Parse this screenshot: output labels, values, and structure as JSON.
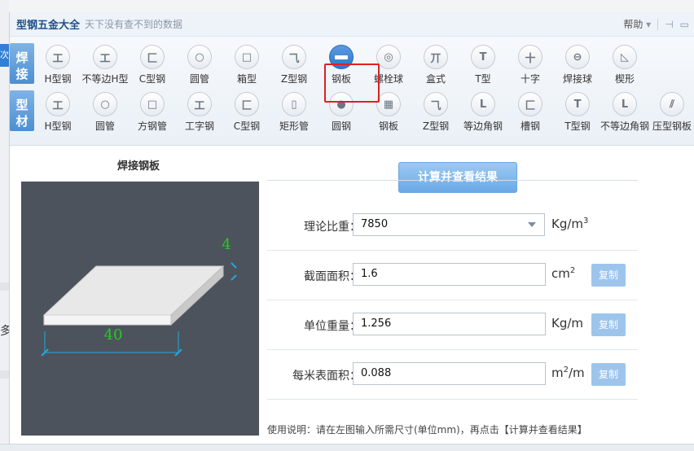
{
  "app": {
    "title": "型钢五金大全",
    "subtitle": "天下没有查不到的数据",
    "help_label": "帮助"
  },
  "background": {
    "left_tab_text": "次",
    "left_fragment": "多"
  },
  "toolbar": {
    "groups": [
      {
        "label_line1": "焊",
        "label_line2": "接",
        "items": [
          {
            "label": "H型钢",
            "icon": "h-beam-icon",
            "glyph": "工"
          },
          {
            "label": "不等边H型",
            "icon": "unequal-h-beam-icon",
            "glyph": "工"
          },
          {
            "label": "C型钢",
            "icon": "c-channel-icon",
            "glyph": "匚"
          },
          {
            "label": "圆管",
            "icon": "round-pipe-icon",
            "glyph": "○"
          },
          {
            "label": "箱型",
            "icon": "box-section-icon",
            "glyph": "□"
          },
          {
            "label": "Z型钢",
            "icon": "z-section-icon",
            "glyph": "⺄"
          },
          {
            "label": "钢板",
            "icon": "steel-plate-icon",
            "glyph": "▬",
            "active": true
          },
          {
            "label": "螺栓球",
            "icon": "bolt-ball-icon",
            "glyph": "◎"
          },
          {
            "label": "盒式",
            "icon": "box-type-icon",
            "glyph": "丌"
          },
          {
            "label": "T型",
            "icon": "t-section-icon",
            "glyph": "T"
          },
          {
            "label": "十字",
            "icon": "cross-section-icon",
            "glyph": "十"
          },
          {
            "label": "焊接球",
            "icon": "welded-ball-icon",
            "glyph": "⊖"
          },
          {
            "label": "楔形",
            "icon": "wedge-icon",
            "glyph": "◺"
          }
        ]
      },
      {
        "label_line1": "型",
        "label_line2": "材",
        "items": [
          {
            "label": "H型钢",
            "icon": "h-beam-icon",
            "glyph": "工"
          },
          {
            "label": "圆管",
            "icon": "round-pipe-icon",
            "glyph": "○"
          },
          {
            "label": "方钢管",
            "icon": "square-pipe-icon",
            "glyph": "□"
          },
          {
            "label": "工字钢",
            "icon": "i-beam-icon",
            "glyph": "工"
          },
          {
            "label": "C型钢",
            "icon": "c-channel-icon",
            "glyph": "匚"
          },
          {
            "label": "矩形管",
            "icon": "rect-pipe-icon",
            "glyph": "▯"
          },
          {
            "label": "圆钢",
            "icon": "round-bar-icon",
            "glyph": "●"
          },
          {
            "label": "钢板",
            "icon": "steel-plate-icon",
            "glyph": "▦"
          },
          {
            "label": "Z型钢",
            "icon": "z-section-icon",
            "glyph": "⺄"
          },
          {
            "label": "等边角钢",
            "icon": "equal-angle-icon",
            "glyph": "L"
          },
          {
            "label": "槽钢",
            "icon": "channel-icon",
            "glyph": "匚"
          },
          {
            "label": "T型钢",
            "icon": "t-section-icon",
            "glyph": "T"
          },
          {
            "label": "不等边角钢",
            "icon": "unequal-angle-icon",
            "glyph": "L"
          },
          {
            "label": "压型钢板",
            "icon": "corrugated-plate-icon",
            "glyph": "⫽"
          }
        ]
      }
    ]
  },
  "diagram": {
    "title": "焊接钢板",
    "dim_thickness": "4",
    "dim_width": "40",
    "colors": {
      "bg": "#4d535c",
      "dim": "#22cc22",
      "ticks": "#1ea8e0"
    }
  },
  "form": {
    "calc_button": "计算并查看结果",
    "rows": [
      {
        "label": "理论比重：",
        "value": "7850",
        "unit_base": "Kg/m",
        "unit_sup": "3",
        "select": true
      },
      {
        "label": "截面面积：",
        "value": "1.6",
        "unit_base": "cm",
        "unit_sup": "2",
        "copy": "复制"
      },
      {
        "label": "单位重量：",
        "value": "1.256",
        "unit_base": "Kg/m",
        "unit_sup": "",
        "copy": "复制"
      },
      {
        "label": "每米表面积：",
        "value": "0.088",
        "unit_base": "m",
        "unit_sup": "2",
        "unit_tail": "/m",
        "copy": "复制"
      }
    ],
    "help_text": "使用说明：请在左图输入所需尺寸(单位mm)，再点击【计算并查看结果】"
  }
}
